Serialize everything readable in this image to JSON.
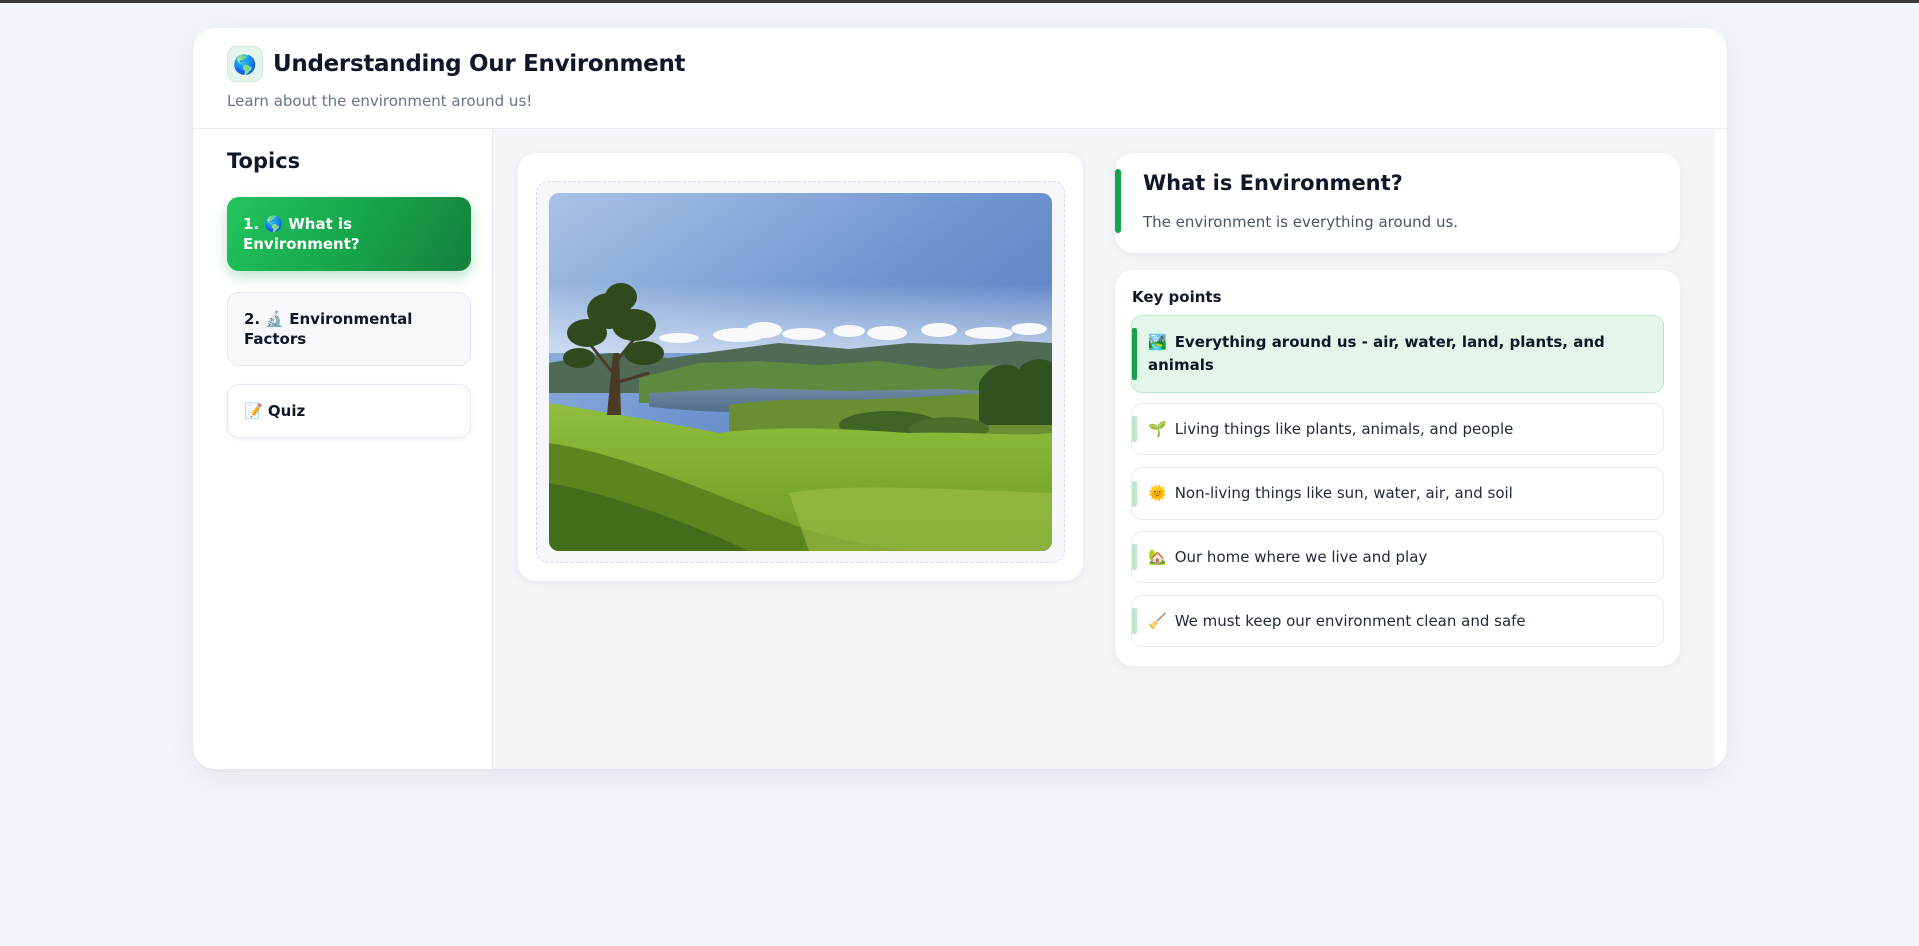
{
  "header": {
    "title": "Understanding Our Environment",
    "title_icon": "globe-icon",
    "subtitle": "Learn about the environment around us!"
  },
  "sidebar": {
    "heading": "Topics",
    "items": [
      {
        "label": "1. 🌎 What is Environment?",
        "active": true
      },
      {
        "label": "2. 🔬 Environmental Factors",
        "active": false
      },
      {
        "label": "📝 Quiz",
        "active": false
      }
    ]
  },
  "main": {
    "image": {
      "alt": "landscape-photo",
      "description_icon": "landscape-image"
    },
    "info": {
      "title": "What is Environment?",
      "text": "The environment is everything around us."
    },
    "key_points": {
      "heading": "Key points",
      "items": [
        {
          "emoji": "🏞️",
          "text": "Everything around us - air, water, land, plants, and animals"
        },
        {
          "emoji": "🌱",
          "text": "Living things like plants, animals, and people"
        },
        {
          "emoji": "🌞",
          "text": "Non-living things like sun, water, air, and soil"
        },
        {
          "emoji": "🏡",
          "text": "Our home where we live and play"
        },
        {
          "emoji": "🧹",
          "text": "We must keep our environment clean and safe"
        }
      ]
    }
  },
  "colors": {
    "accent": "#16a34a",
    "accent_light": "#22c55e",
    "background": "#f1f4f9",
    "highlight_bg": "#e4f6e9"
  }
}
